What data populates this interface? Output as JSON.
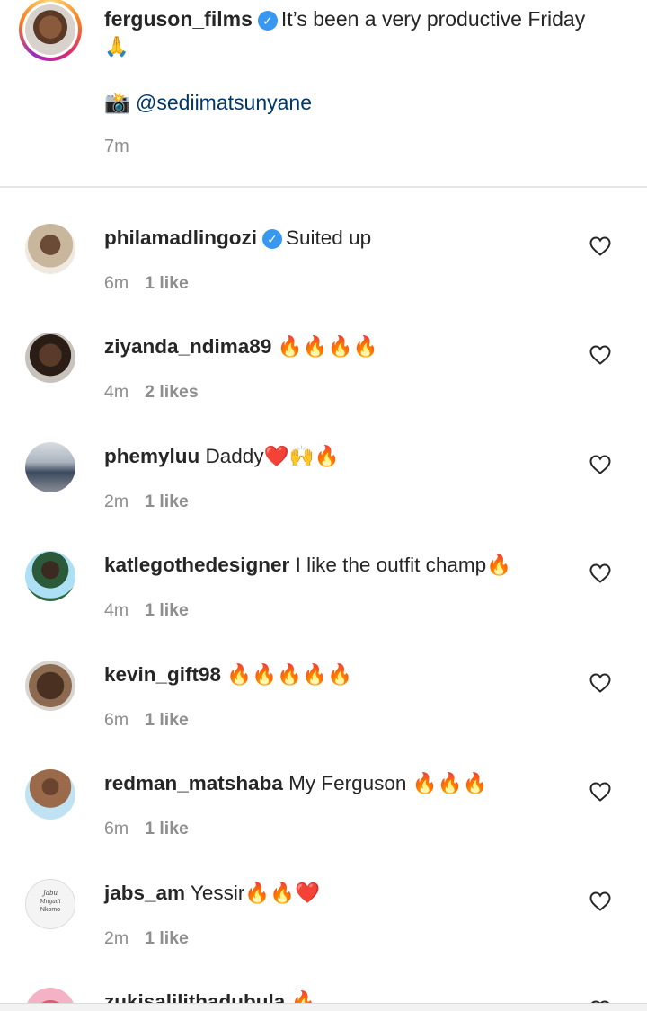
{
  "caption": {
    "username": "ferguson_films",
    "text": "It’s been a very productive Friday",
    "emoji": "🙏",
    "camera_emoji": "📸",
    "mention": "@sediimatsunyane",
    "time": "7m"
  },
  "comments": [
    {
      "username": "philamadlingozi",
      "verified": true,
      "text": "Suited up",
      "time": "6m",
      "likes": "1 like"
    },
    {
      "username": "ziyanda_ndima89",
      "verified": false,
      "text": "🔥🔥🔥🔥",
      "time": "4m",
      "likes": "2 likes"
    },
    {
      "username": "phemyluu",
      "verified": false,
      "text": "Daddy❤️🙌🔥",
      "time": "2m",
      "likes": "1 like"
    },
    {
      "username": "katlegothedesigner",
      "verified": false,
      "text": "I like the outfit champ🔥",
      "time": "4m",
      "likes": "1 like"
    },
    {
      "username": "kevin_gift98",
      "verified": false,
      "text": "🔥🔥🔥🔥🔥",
      "time": "6m",
      "likes": "1 like"
    },
    {
      "username": "redman_matshaba",
      "verified": false,
      "text": "My Ferguson 🔥🔥🔥",
      "time": "6m",
      "likes": "1 like"
    },
    {
      "username": "jabs_am",
      "verified": false,
      "text": "Yessir🔥🔥❤️",
      "time": "2m",
      "likes": "1 like",
      "avatar_text": [
        "Jabu",
        "Mngadi",
        "Nkomo"
      ]
    },
    {
      "username": "zukisalilithadubula",
      "verified": false,
      "text": "🔥",
      "time": "",
      "likes": ""
    }
  ],
  "colors": {
    "verified": "#3897f0",
    "mention": "#00376b",
    "meta": "#8e8e8e"
  },
  "icons": {
    "verified": "verified-badge-icon",
    "like": "heart-outline-icon"
  }
}
